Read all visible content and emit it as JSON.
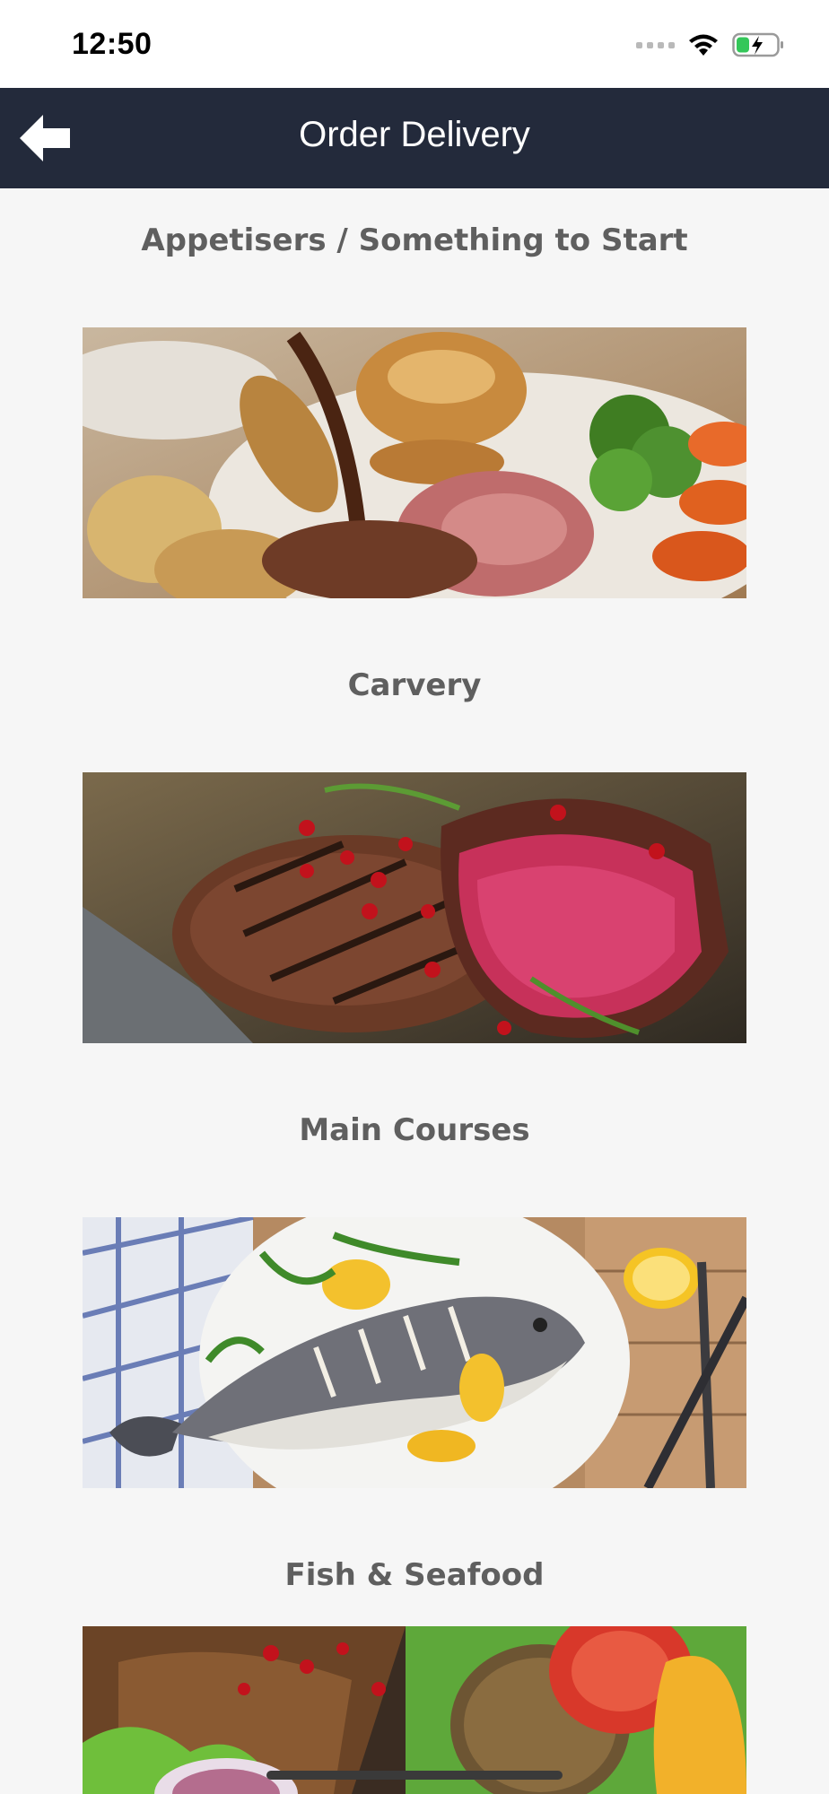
{
  "status_bar": {
    "time": "12:50",
    "icons": [
      "signal-dots-icon",
      "wifi-icon",
      "battery-charging-icon"
    ]
  },
  "header": {
    "title": "Order Delivery",
    "back_icon": "arrow-left-icon"
  },
  "categories": [
    {
      "label": "Appetisers / Something to Start",
      "image": "roast-dinner-photo"
    },
    {
      "label": "Carvery",
      "image": "grilled-steak-photo"
    },
    {
      "label": "Main Courses",
      "image": "grilled-fish-photo"
    },
    {
      "label": "Fish & Seafood",
      "image": "burger-salad-photo"
    }
  ],
  "colors": {
    "header_bg": "#232a3b",
    "page_bg": "#f6f6f6",
    "title_text": "#5f5f5f"
  }
}
